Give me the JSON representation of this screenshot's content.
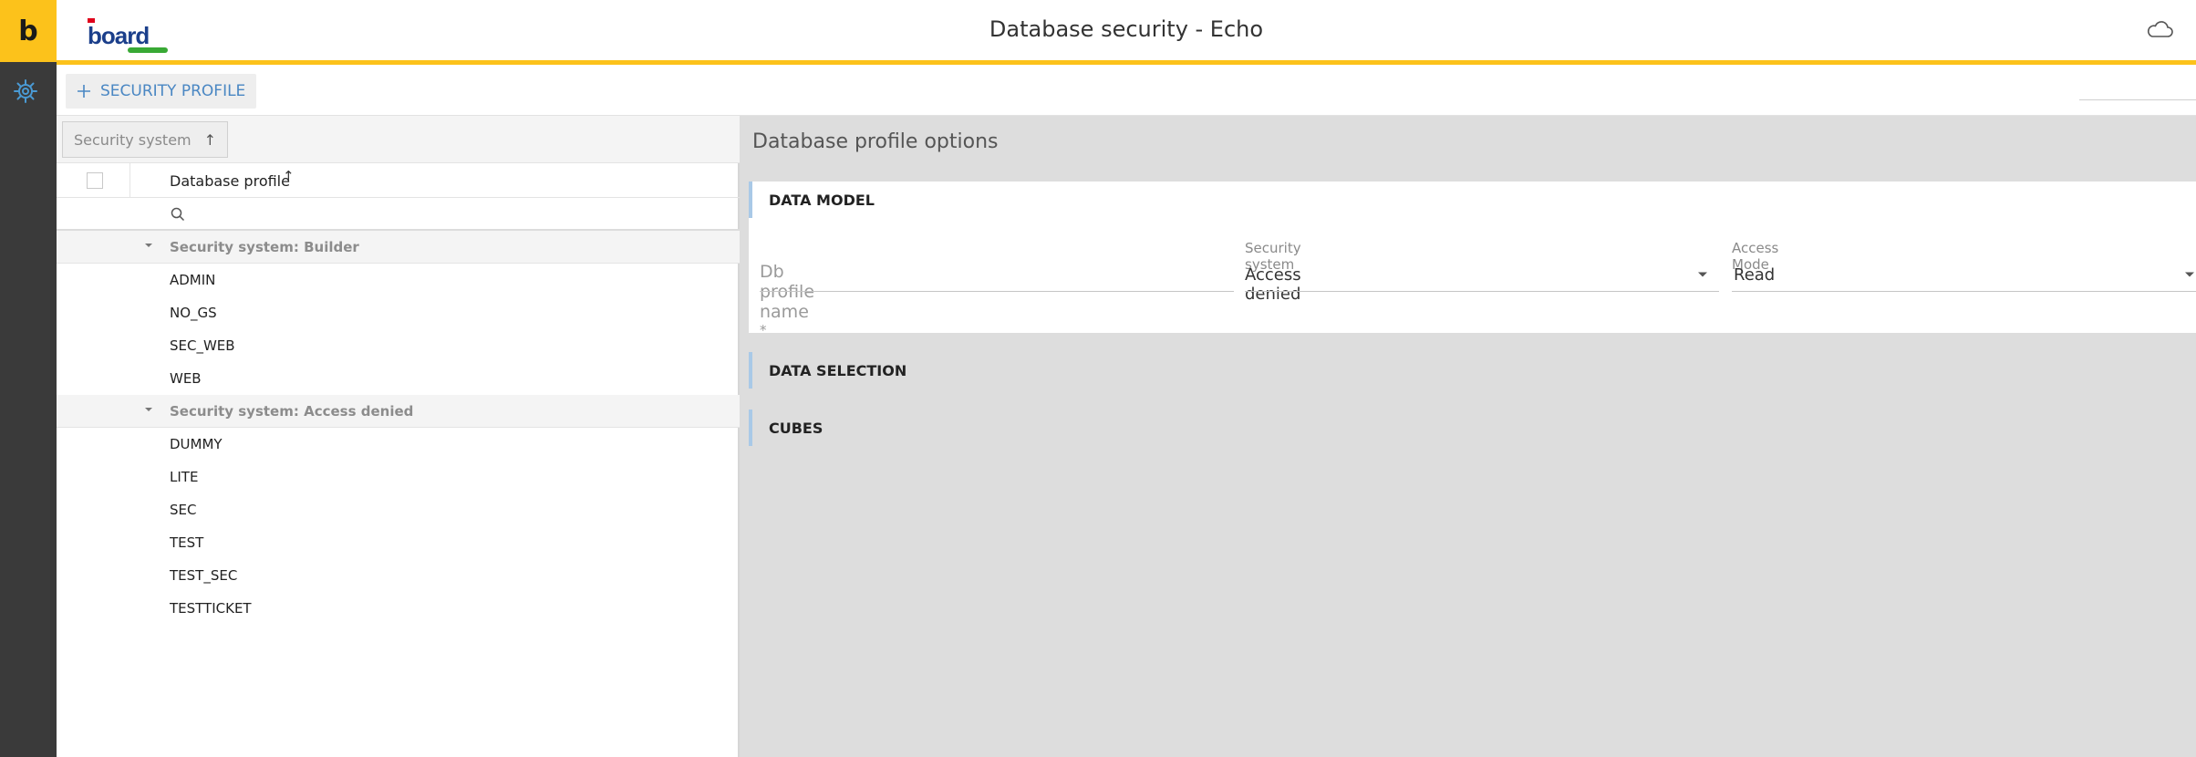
{
  "app": {
    "title": "Database security - Echo",
    "logo_letter": "b",
    "brand_text": "board"
  },
  "toolbar": {
    "add_label": "SECURITY PROFILE"
  },
  "list": {
    "groupby_chip": "Security system",
    "groupby_sort": "↑",
    "column_title": "Database profile",
    "column_sort": "↑",
    "search_placeholder": "",
    "groups": [
      {
        "label": "Security system: Builder",
        "items": [
          "ADMIN",
          "NO_GS",
          "SEC_WEB",
          "WEB"
        ]
      },
      {
        "label": "Security system: Access denied",
        "items": [
          "DUMMY",
          "LITE",
          "SEC",
          "TEST",
          "TEST_SEC",
          "TESTTICKET"
        ]
      }
    ]
  },
  "options": {
    "title": "Database profile options",
    "sections": {
      "data_model": "DATA MODEL",
      "data_selection": "DATA SELECTION",
      "cubes": "CUBES"
    },
    "fields": {
      "db_profile_name_placeholder": "Db profile name",
      "required_mark": "*",
      "security_system_label": "Security system",
      "security_system_value": "Access denied",
      "access_mode_label": "Access Mode",
      "access_mode_value": "Read"
    }
  },
  "colors": {
    "accent_yellow": "#fcc21b",
    "rail_dark": "#3a3a3a",
    "link_blue": "#4a87c3",
    "section_border": "#a9c9e7"
  }
}
